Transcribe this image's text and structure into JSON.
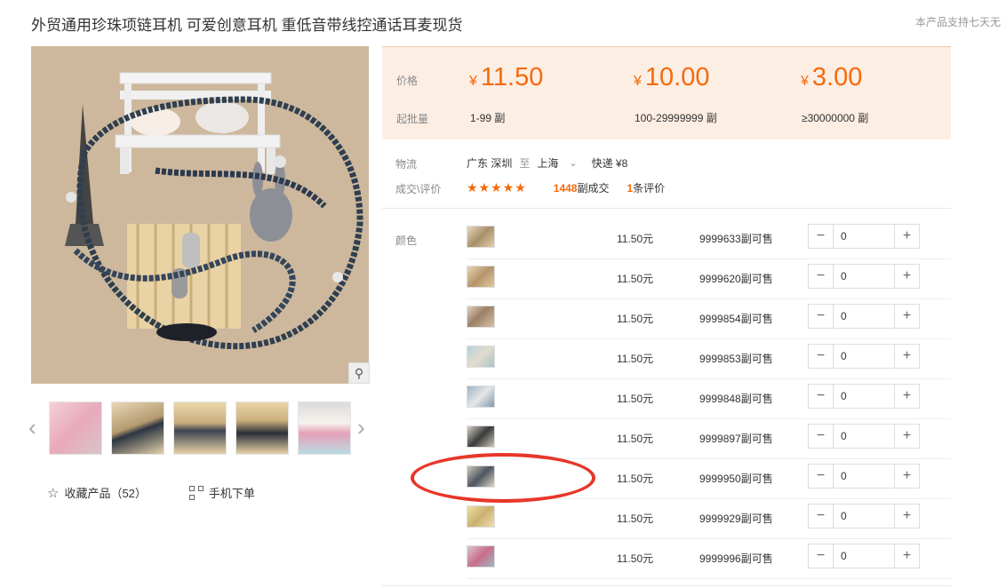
{
  "product": {
    "title": "外贸通用珍珠项链耳机 可爱创意耳机 重低音带线控通话耳麦现货",
    "support_text": "本产品支持七天无"
  },
  "icons": {
    "zoom": "magnifier-icon",
    "prev": "chevron-left-icon",
    "next": "chevron-right-icon",
    "fav": "star-outline-icon",
    "qr": "qr-code-icon"
  },
  "colors": {
    "accent": "#f56a0a",
    "price_bg": "#fdeee4",
    "annotation": "#e8362a"
  },
  "actions": {
    "favorite": "收藏产品（52）",
    "mobile_order": "手机下单"
  },
  "pricing": {
    "price_label": "价格",
    "moq_label": "起批量",
    "currency": "¥",
    "tiers": [
      {
        "price": "11.50",
        "range": "1-99 副"
      },
      {
        "price": "10.00",
        "range": "100-29999999 副"
      },
      {
        "price": "3.00",
        "range": "≥30000000 副"
      }
    ]
  },
  "logistics": {
    "label": "物流",
    "from": "广东 深圳",
    "to_word": "至",
    "to": "上海",
    "method": "快递 ¥8"
  },
  "deals": {
    "label": "成交\\评价",
    "stars": "★★★★★",
    "count": "1448",
    "count_suffix": "副成交",
    "reviews": "1",
    "reviews_suffix": "条评价"
  },
  "sku": {
    "label": "颜色",
    "rows": [
      {
        "price": "11.50元",
        "stock": "9999633副可售",
        "qty": "0"
      },
      {
        "price": "11.50元",
        "stock": "9999620副可售",
        "qty": "0"
      },
      {
        "price": "11.50元",
        "stock": "9999854副可售",
        "qty": "0"
      },
      {
        "price": "11.50元",
        "stock": "9999853副可售",
        "qty": "0"
      },
      {
        "price": "11.50元",
        "stock": "9999848副可售",
        "qty": "0"
      },
      {
        "price": "11.50元",
        "stock": "9999897副可售",
        "qty": "0"
      },
      {
        "price": "11.50元",
        "stock": "9999950副可售",
        "qty": "0"
      },
      {
        "price": "11.50元",
        "stock": "9999929副可售",
        "qty": "0"
      },
      {
        "price": "11.50元",
        "stock": "9999996副可售",
        "qty": "0"
      }
    ]
  }
}
